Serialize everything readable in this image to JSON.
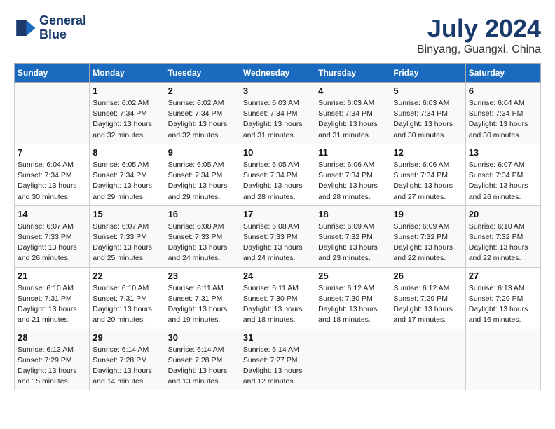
{
  "header": {
    "logo_line1": "General",
    "logo_line2": "Blue",
    "title": "July 2024",
    "subtitle": "Binyang, Guangxi, China"
  },
  "days_of_week": [
    "Sunday",
    "Monday",
    "Tuesday",
    "Wednesday",
    "Thursday",
    "Friday",
    "Saturday"
  ],
  "weeks": [
    [
      {
        "day": "",
        "info": ""
      },
      {
        "day": "1",
        "info": "Sunrise: 6:02 AM\nSunset: 7:34 PM\nDaylight: 13 hours\nand 32 minutes."
      },
      {
        "day": "2",
        "info": "Sunrise: 6:02 AM\nSunset: 7:34 PM\nDaylight: 13 hours\nand 32 minutes."
      },
      {
        "day": "3",
        "info": "Sunrise: 6:03 AM\nSunset: 7:34 PM\nDaylight: 13 hours\nand 31 minutes."
      },
      {
        "day": "4",
        "info": "Sunrise: 6:03 AM\nSunset: 7:34 PM\nDaylight: 13 hours\nand 31 minutes."
      },
      {
        "day": "5",
        "info": "Sunrise: 6:03 AM\nSunset: 7:34 PM\nDaylight: 13 hours\nand 30 minutes."
      },
      {
        "day": "6",
        "info": "Sunrise: 6:04 AM\nSunset: 7:34 PM\nDaylight: 13 hours\nand 30 minutes."
      }
    ],
    [
      {
        "day": "7",
        "info": "Sunrise: 6:04 AM\nSunset: 7:34 PM\nDaylight: 13 hours\nand 30 minutes."
      },
      {
        "day": "8",
        "info": "Sunrise: 6:05 AM\nSunset: 7:34 PM\nDaylight: 13 hours\nand 29 minutes."
      },
      {
        "day": "9",
        "info": "Sunrise: 6:05 AM\nSunset: 7:34 PM\nDaylight: 13 hours\nand 29 minutes."
      },
      {
        "day": "10",
        "info": "Sunrise: 6:05 AM\nSunset: 7:34 PM\nDaylight: 13 hours\nand 28 minutes."
      },
      {
        "day": "11",
        "info": "Sunrise: 6:06 AM\nSunset: 7:34 PM\nDaylight: 13 hours\nand 28 minutes."
      },
      {
        "day": "12",
        "info": "Sunrise: 6:06 AM\nSunset: 7:34 PM\nDaylight: 13 hours\nand 27 minutes."
      },
      {
        "day": "13",
        "info": "Sunrise: 6:07 AM\nSunset: 7:34 PM\nDaylight: 13 hours\nand 26 minutes."
      }
    ],
    [
      {
        "day": "14",
        "info": "Sunrise: 6:07 AM\nSunset: 7:33 PM\nDaylight: 13 hours\nand 26 minutes."
      },
      {
        "day": "15",
        "info": "Sunrise: 6:07 AM\nSunset: 7:33 PM\nDaylight: 13 hours\nand 25 minutes."
      },
      {
        "day": "16",
        "info": "Sunrise: 6:08 AM\nSunset: 7:33 PM\nDaylight: 13 hours\nand 24 minutes."
      },
      {
        "day": "17",
        "info": "Sunrise: 6:08 AM\nSunset: 7:33 PM\nDaylight: 13 hours\nand 24 minutes."
      },
      {
        "day": "18",
        "info": "Sunrise: 6:09 AM\nSunset: 7:32 PM\nDaylight: 13 hours\nand 23 minutes."
      },
      {
        "day": "19",
        "info": "Sunrise: 6:09 AM\nSunset: 7:32 PM\nDaylight: 13 hours\nand 22 minutes."
      },
      {
        "day": "20",
        "info": "Sunrise: 6:10 AM\nSunset: 7:32 PM\nDaylight: 13 hours\nand 22 minutes."
      }
    ],
    [
      {
        "day": "21",
        "info": "Sunrise: 6:10 AM\nSunset: 7:31 PM\nDaylight: 13 hours\nand 21 minutes."
      },
      {
        "day": "22",
        "info": "Sunrise: 6:10 AM\nSunset: 7:31 PM\nDaylight: 13 hours\nand 20 minutes."
      },
      {
        "day": "23",
        "info": "Sunrise: 6:11 AM\nSunset: 7:31 PM\nDaylight: 13 hours\nand 19 minutes."
      },
      {
        "day": "24",
        "info": "Sunrise: 6:11 AM\nSunset: 7:30 PM\nDaylight: 13 hours\nand 18 minutes."
      },
      {
        "day": "25",
        "info": "Sunrise: 6:12 AM\nSunset: 7:30 PM\nDaylight: 13 hours\nand 18 minutes."
      },
      {
        "day": "26",
        "info": "Sunrise: 6:12 AM\nSunset: 7:29 PM\nDaylight: 13 hours\nand 17 minutes."
      },
      {
        "day": "27",
        "info": "Sunrise: 6:13 AM\nSunset: 7:29 PM\nDaylight: 13 hours\nand 16 minutes."
      }
    ],
    [
      {
        "day": "28",
        "info": "Sunrise: 6:13 AM\nSunset: 7:29 PM\nDaylight: 13 hours\nand 15 minutes."
      },
      {
        "day": "29",
        "info": "Sunrise: 6:14 AM\nSunset: 7:28 PM\nDaylight: 13 hours\nand 14 minutes."
      },
      {
        "day": "30",
        "info": "Sunrise: 6:14 AM\nSunset: 7:28 PM\nDaylight: 13 hours\nand 13 minutes."
      },
      {
        "day": "31",
        "info": "Sunrise: 6:14 AM\nSunset: 7:27 PM\nDaylight: 13 hours\nand 12 minutes."
      },
      {
        "day": "",
        "info": ""
      },
      {
        "day": "",
        "info": ""
      },
      {
        "day": "",
        "info": ""
      }
    ]
  ]
}
